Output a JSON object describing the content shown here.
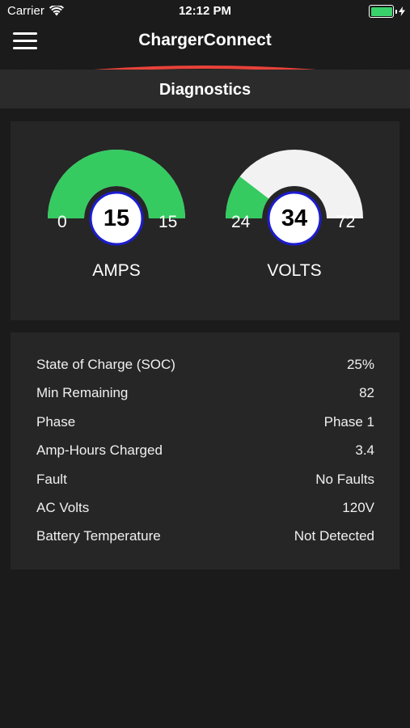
{
  "status_bar": {
    "carrier": "Carrier",
    "time": "12:12 PM",
    "battery_color": "#38d16a"
  },
  "nav": {
    "menu_icon": "hamburger-menu-icon",
    "title": "ChargerConnect",
    "accent_color": "#e8423a"
  },
  "section": {
    "title": "Diagnostics"
  },
  "gauges": [
    {
      "label": "AMPS",
      "value": "15",
      "min": "0",
      "max": "15",
      "level": 1.0,
      "fill_color": "#35cb61",
      "track_color": "#f2f2f2"
    },
    {
      "label": "VOLTS",
      "value": "34",
      "min": "24",
      "max": "72",
      "level": 0.2083,
      "fill_color": "#35cb61",
      "track_color": "#f2f2f2"
    }
  ],
  "info_rows": [
    {
      "label": "State of Charge (SOC)",
      "value": "25%"
    },
    {
      "label": "Min Remaining",
      "value": "82"
    },
    {
      "label": "Phase",
      "value": "Phase 1"
    },
    {
      "label": "Amp-Hours Charged",
      "value": "3.4"
    },
    {
      "label": "Fault",
      "value": "No Faults"
    },
    {
      "label": "AC Volts",
      "value": "120V"
    },
    {
      "label": "Battery Temperature",
      "value": "Not Detected"
    }
  ]
}
